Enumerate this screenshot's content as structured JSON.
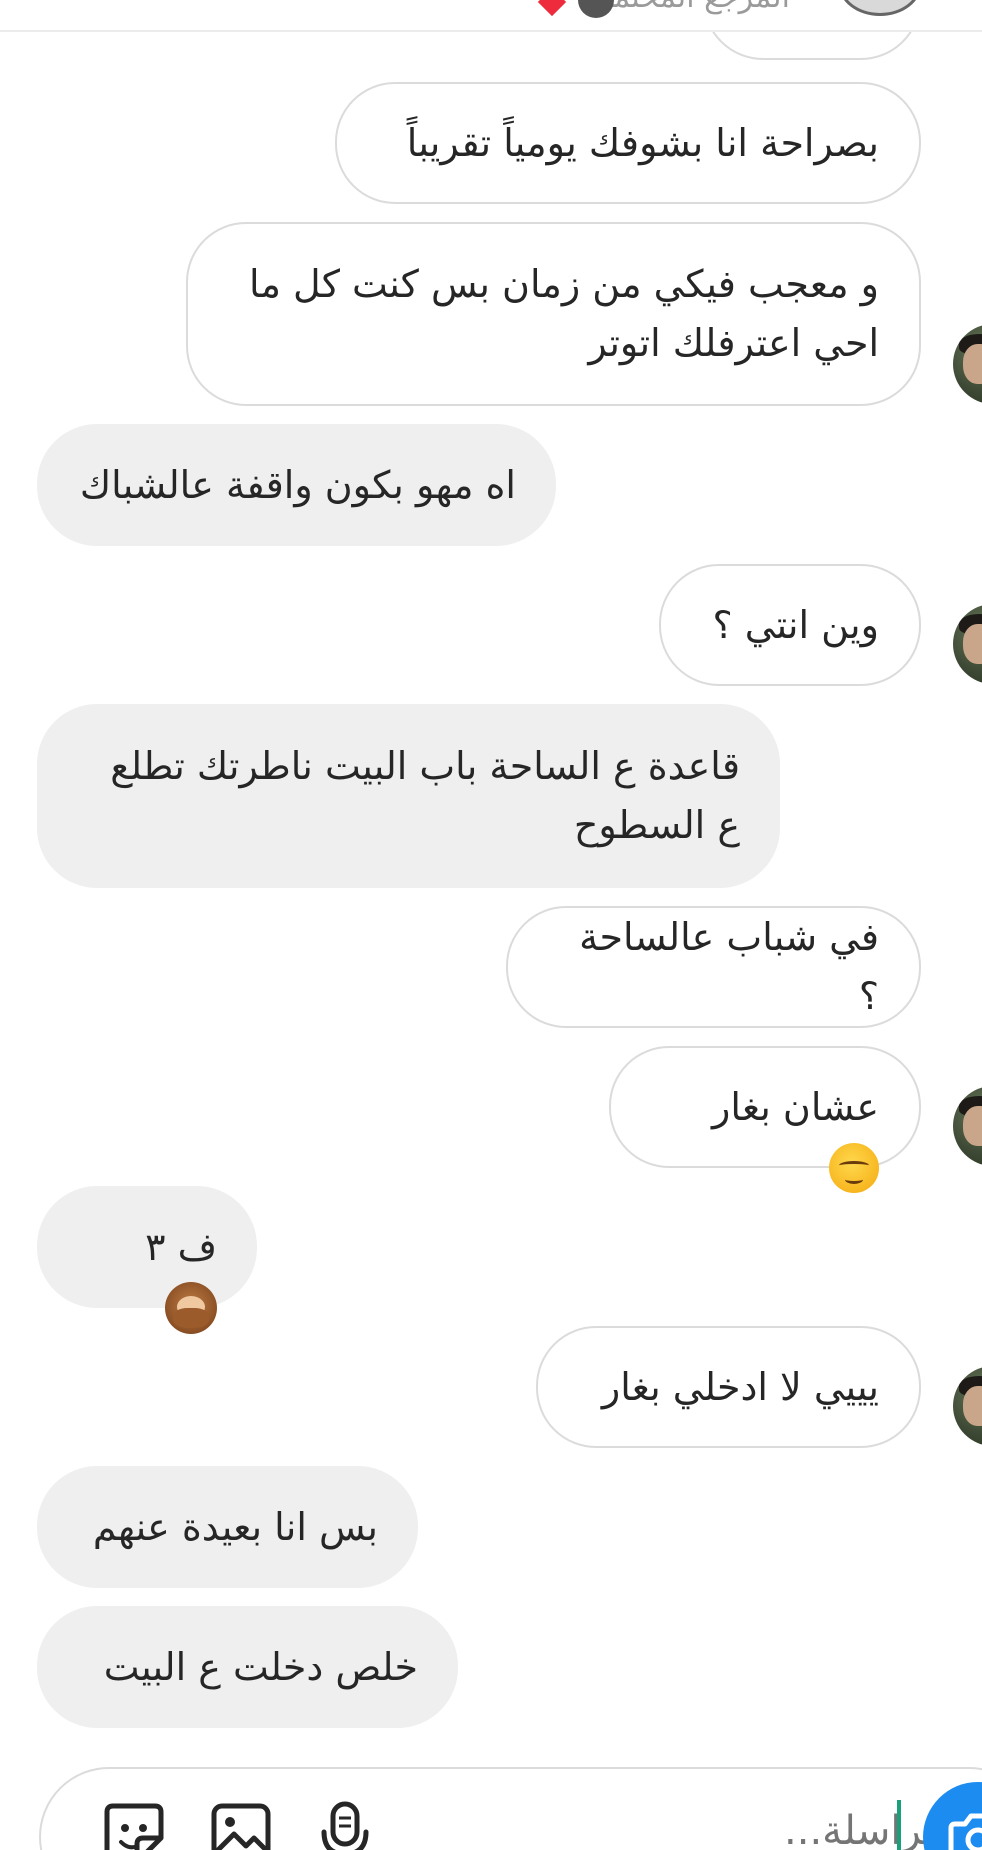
{
  "header": {
    "partial_text": "المرجع المحتملي"
  },
  "messages": [
    {
      "side": "sent",
      "text": "بصراحة انا بشوفك يومياً تقريباً"
    },
    {
      "side": "sent",
      "text": "و معجب فيكي من زمان بس كنت كل ما\nاحي اعترفلك اتوتر"
    },
    {
      "side": "received",
      "text": "اه مهو بكون واقفة عالشباك"
    },
    {
      "side": "sent",
      "text": "وين انتي ؟"
    },
    {
      "side": "received",
      "text": "قاعدة ع الساحة باب البيت ناطرتك تطلع\nع السطوح"
    },
    {
      "side": "sent",
      "text": "في شباب عالساحة ؟"
    },
    {
      "side": "sent",
      "text": "عشان بغار",
      "emoji": "relieved-face"
    },
    {
      "side": "received",
      "text": "ف ٣",
      "emoji": "see-no-evil-monkey"
    },
    {
      "side": "sent",
      "text": "يييي لا ادخلي بغار"
    },
    {
      "side": "received",
      "text": "بس انا بعيدة عنهم"
    },
    {
      "side": "received",
      "text": "خلص دخلت ع البيت"
    }
  ],
  "composer": {
    "placeholder": "مراسلة...",
    "icons": [
      "sticker-icon",
      "gallery-icon",
      "microphone-icon",
      "camera-icon"
    ]
  },
  "colors": {
    "sent_bubble_bg": "#ffffff",
    "sent_bubble_border": "#dbdbdb",
    "received_bubble_bg": "#efefef",
    "text": "#262626",
    "camera_button": "#1d8cf0",
    "caret": "#1aa07a"
  }
}
